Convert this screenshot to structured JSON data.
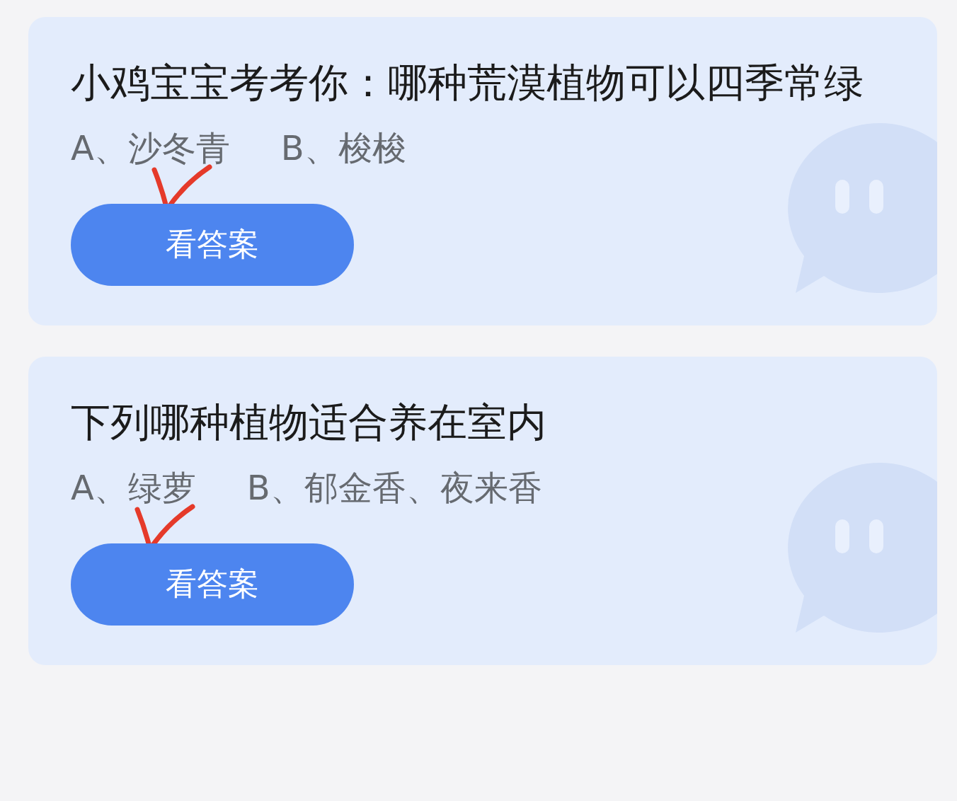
{
  "cards": [
    {
      "question": "小鸡宝宝考考你：哪种荒漠植物可以四季常绿",
      "options": [
        {
          "text": "A、沙冬青",
          "checked": true
        },
        {
          "text": "B、梭梭",
          "checked": false
        }
      ],
      "button": "看答案"
    },
    {
      "question": "下列哪种植物适合养在室内",
      "options": [
        {
          "text": "A、绿萝",
          "checked": true
        },
        {
          "text": "B、郁金香、夜来香",
          "checked": false
        }
      ],
      "button": "看答案"
    }
  ]
}
